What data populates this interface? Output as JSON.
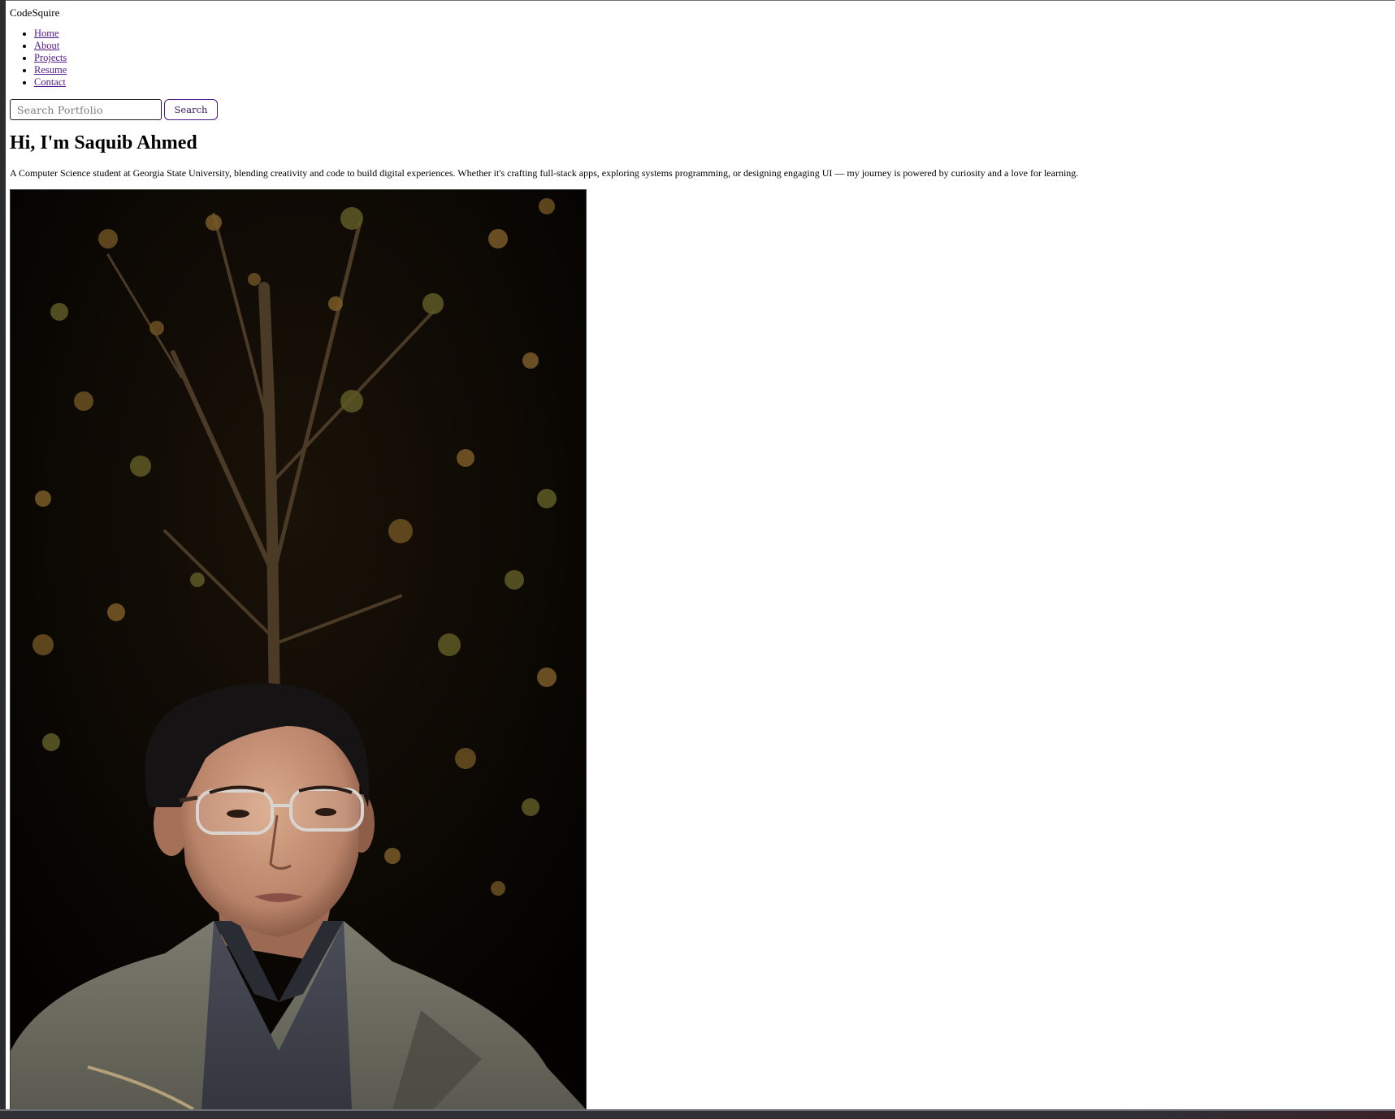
{
  "site": {
    "brand": "CodeSquire"
  },
  "nav": {
    "items": [
      {
        "label": "Home"
      },
      {
        "label": "About"
      },
      {
        "label": "Projects"
      },
      {
        "label": "Resume"
      },
      {
        "label": "Contact"
      }
    ]
  },
  "search": {
    "placeholder": "Search Portfolio",
    "value": "",
    "button_label": "Search"
  },
  "hero": {
    "title": "Hi, I'm Saquib Ahmed",
    "intro": "A Computer Science student at Georgia State University, blending creativity and code to build digital experiences. Whether it's crafting full-stack apps, exploring systems programming, or designing engaging UI — my journey is powered by curiosity and a love for learning."
  },
  "colors": {
    "link": "#551a8b",
    "page_background": "#ffffff",
    "window_frame": "#2b2d31"
  }
}
